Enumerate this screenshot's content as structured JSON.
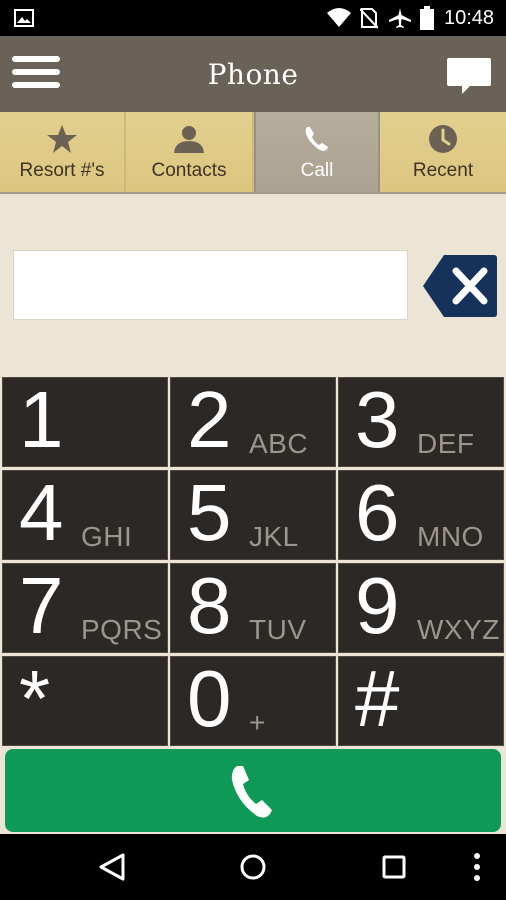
{
  "status_bar": {
    "time": "10:48",
    "icons": [
      "gallery-icon",
      "wifi-icon",
      "no-sim-icon",
      "airplane-icon",
      "battery-icon"
    ]
  },
  "action_bar": {
    "title": "Phone",
    "menu_icon": "hamburger-menu-icon",
    "message_icon": "chat-bubble-icon"
  },
  "tabs": [
    {
      "label": "Resort #'s",
      "icon": "star-icon",
      "active": false
    },
    {
      "label": "Contacts",
      "icon": "person-icon",
      "active": false
    },
    {
      "label": "Call",
      "icon": "phone-icon",
      "active": true
    },
    {
      "label": "Recent",
      "icon": "clock-icon",
      "active": false
    }
  ],
  "dial_input": {
    "value": "",
    "clear_icon": "backspace-x-icon"
  },
  "keypad": [
    {
      "digit": "1",
      "letters": ""
    },
    {
      "digit": "2",
      "letters": "ABC"
    },
    {
      "digit": "3",
      "letters": "DEF"
    },
    {
      "digit": "4",
      "letters": "GHI"
    },
    {
      "digit": "5",
      "letters": "JKL"
    },
    {
      "digit": "6",
      "letters": "MNO"
    },
    {
      "digit": "7",
      "letters": "PQRS"
    },
    {
      "digit": "8",
      "letters": "TUV"
    },
    {
      "digit": "9",
      "letters": "WXYZ"
    },
    {
      "digit": "*",
      "letters": ""
    },
    {
      "digit": "0",
      "letters": "+"
    },
    {
      "digit": "#",
      "letters": ""
    }
  ],
  "call_button": {
    "icon": "phone-handset-icon",
    "color": "#0e9a56"
  },
  "colors": {
    "action_bar": "#6a6258",
    "tab_bg": "#e3d08f",
    "tab_active": "#b7ad9d",
    "keypad_key": "#2b2826",
    "panel_bg": "#ece5d5",
    "backspace": "#17325a"
  },
  "nav_bar": {
    "icons": [
      "back-icon",
      "home-icon",
      "recents-icon",
      "overflow-menu-icon"
    ]
  }
}
